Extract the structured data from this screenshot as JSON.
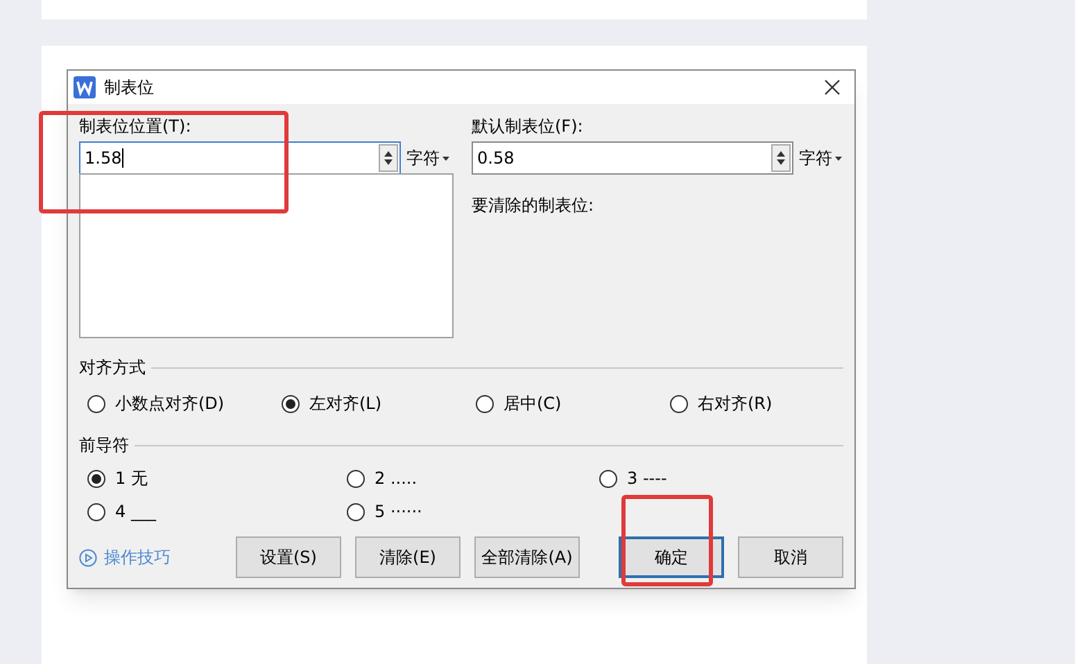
{
  "window": {
    "title": "制表位"
  },
  "tab_position": {
    "label": "制表位位置(T):",
    "value": "1.58",
    "unit": "字符"
  },
  "default_tab": {
    "label": "默认制表位(F):",
    "value": "0.58",
    "unit": "字符"
  },
  "clear_label": "要清除的制表位:",
  "alignment": {
    "title": "对齐方式",
    "options": [
      {
        "label": "小数点对齐(D)",
        "selected": false
      },
      {
        "label": "左对齐(L)",
        "selected": true
      },
      {
        "label": "居中(C)",
        "selected": false
      },
      {
        "label": "右对齐(R)",
        "selected": false
      }
    ]
  },
  "leader": {
    "title": "前导符",
    "options": [
      {
        "label": "1 无",
        "selected": true
      },
      {
        "label": "2 .....",
        "selected": false
      },
      {
        "label": "3 ----",
        "selected": false
      },
      {
        "label": "4 ___",
        "selected": false
      },
      {
        "label": "5 ······",
        "selected": false
      }
    ]
  },
  "tips_link": "操作技巧",
  "buttons": [
    {
      "label": "设置(S)",
      "focused": false
    },
    {
      "label": "清除(E)",
      "focused": false
    },
    {
      "label": "全部清除(A)",
      "focused": false
    },
    {
      "label": "确定",
      "focused": true
    },
    {
      "label": "取消",
      "focused": false
    }
  ]
}
